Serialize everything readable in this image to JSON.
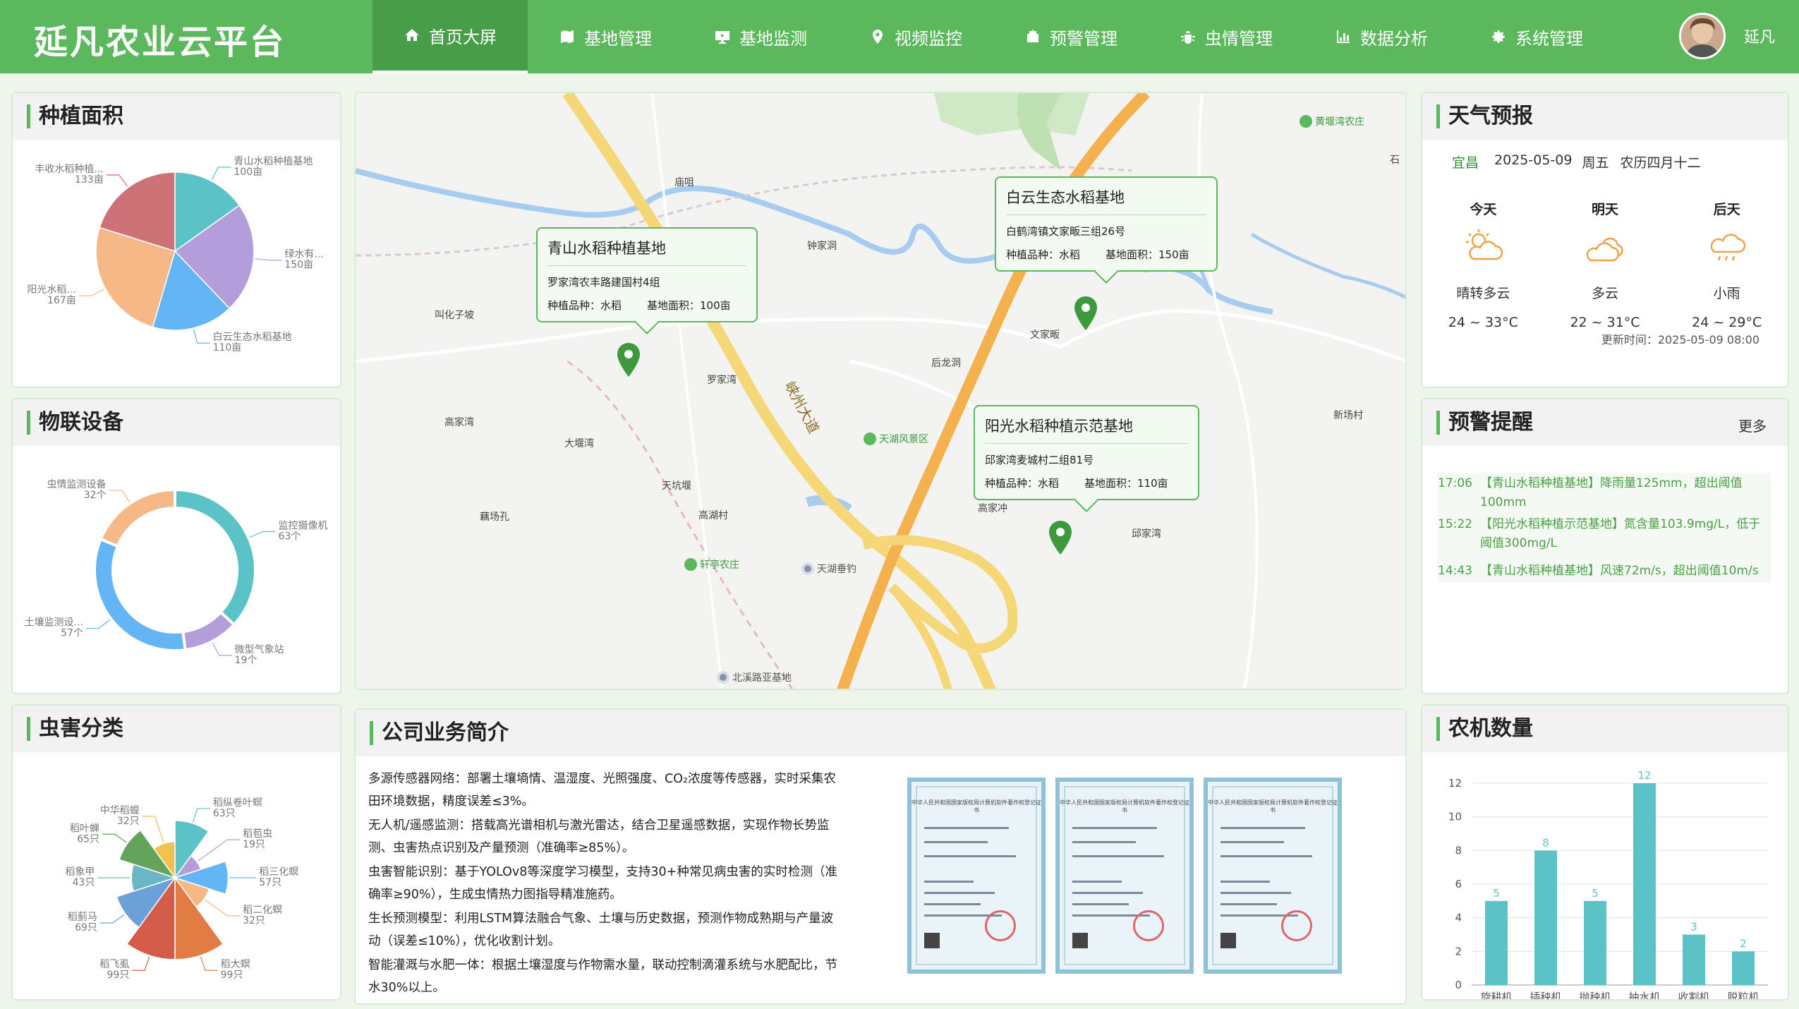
{
  "app": {
    "title": "延凡农业云平台"
  },
  "nav": [
    {
      "label": "首页大屏",
      "icon": "home-icon"
    },
    {
      "label": "基地管理",
      "icon": "map-icon"
    },
    {
      "label": "基地监测",
      "icon": "monitor-icon"
    },
    {
      "label": "视频监控",
      "icon": "location-icon"
    },
    {
      "label": "预警管理",
      "icon": "bell-icon"
    },
    {
      "label": "虫情管理",
      "icon": "bug-icon"
    },
    {
      "label": "数据分析",
      "icon": "chart-icon"
    },
    {
      "label": "系统管理",
      "icon": "gear-icon"
    }
  ],
  "user": {
    "name": "延凡"
  },
  "planting": {
    "title": "种植面积",
    "chart_data": {
      "type": "pie",
      "unit": "亩",
      "slices": [
        {
          "name": "青山水稻种植基地",
          "value": 100,
          "color": "#5bc3c7"
        },
        {
          "name": "绿水有...",
          "value": 150,
          "color": "#b39ddb"
        },
        {
          "name": "白云生态水稻基地",
          "value": 110,
          "color": "#64b5f6"
        },
        {
          "name": "阳光水稻...",
          "value": 167,
          "color": "#f6b886"
        },
        {
          "name": "丰收水稻种植...",
          "value": 133,
          "color": "#cd7378"
        }
      ],
      "labels": [
        "青山水稻种植基地",
        "100亩",
        "绿水有...",
        "150亩",
        "白云生态水稻基地",
        "110亩",
        "阳光水稻...",
        "167亩",
        "丰收水稻种植...",
        "133亩"
      ]
    }
  },
  "iot": {
    "title": "物联设备",
    "chart_data": {
      "type": "pie",
      "variant": "donut",
      "unit": "个",
      "slices": [
        {
          "name": "监控摄像机",
          "value": 63,
          "color": "#5bc3c7"
        },
        {
          "name": "微型气象站",
          "value": 19,
          "color": "#b39ddb"
        },
        {
          "name": "土壤监测设...",
          "value": 57,
          "color": "#64b5f6"
        },
        {
          "name": "虫情监测设备",
          "value": 32,
          "color": "#f6b886"
        }
      ],
      "labels": [
        "监控摄像机",
        "63个",
        "微型气象站",
        "19个",
        "土壤监测设...",
        "57个",
        "虫情监测设备",
        "32个"
      ]
    }
  },
  "pests": {
    "title": "虫害分类",
    "chart_data": {
      "type": "pie",
      "variant": "rose",
      "unit": "只",
      "slices": [
        {
          "name": "稻纵卷叶螟",
          "value": 63,
          "color": "#5bc3c7"
        },
        {
          "name": "稻苞虫",
          "value": 19,
          "color": "#b39ddb"
        },
        {
          "name": "稻三化螟",
          "value": 57,
          "color": "#64b5f6"
        },
        {
          "name": "稻二化螟",
          "value": 32,
          "color": "#f6b886"
        },
        {
          "name": "稻大螟",
          "value": 99,
          "color": "#e07c44"
        },
        {
          "name": "稻飞虱",
          "value": 99,
          "color": "#d45c4a"
        },
        {
          "name": "稻蓟马",
          "value": 69,
          "color": "#6aa1d8"
        },
        {
          "name": "稻象甲",
          "value": 43,
          "color": "#6ab6c4"
        },
        {
          "name": "稻叶蝉",
          "value": 65,
          "color": "#63a35c"
        },
        {
          "name": "中华稻蝗",
          "value": 32,
          "color": "#f2c14e"
        }
      ],
      "labels": [
        "稻纵卷叶螟",
        "63只",
        "稻苞虫",
        "19只",
        "稻三化螟",
        "57只",
        "稻二化螟",
        "32只",
        "稻大螟",
        "99只",
        "稻飞虱",
        "99只",
        "稻蓟马",
        "69只",
        "稻象甲",
        "43只",
        "稻叶蝉",
        "65只",
        "中华稻蝗",
        "32只"
      ]
    }
  },
  "map": {
    "bases": [
      {
        "name": "青山水稻种植基地",
        "address": "罗家湾农丰路建国村4组",
        "crop": "种植品种：水稻",
        "area": "基地面积：100亩"
      },
      {
        "name": "白云生态水稻基地",
        "address": "白鹤湾镇文家畈三组26号",
        "crop": "种植品种：水稻",
        "area": "基地面积：150亩"
      },
      {
        "name": "阳光水稻种植示范基地",
        "address": "邱家湾麦城村二组81号",
        "crop": "种植品种：水稻",
        "area": "基地面积：110亩"
      }
    ],
    "places": [
      "庙咀",
      "钟家洞",
      "叫化子坡",
      "罗家湾",
      "高家湾",
      "大堰湾",
      "后龙洞",
      "文家畈",
      "天坑堰",
      "高湖村",
      "藕场孔",
      "邱家湾",
      "新场村",
      "高家冲",
      "石",
      "峡州大道"
    ],
    "pois": [
      "黄堰湾农庄",
      "天湖风景区",
      "轩亭农庄"
    ],
    "gray_pois": [
      "天湖垂钓",
      "北溪路亚基地"
    ]
  },
  "company": {
    "title": "公司业务简介",
    "paragraphs": [
      "多源传感器网络：部署土壤墒情、温湿度、光照强度、CO₂浓度等传感器，实时采集农田环境数据，精度误差≤3%。",
      "无人机/遥感监测：搭载高光谱相机与激光雷达，结合卫星遥感数据，实现作物长势监测、虫害热点识别及产量预测（准确率≥85%）。",
      "虫害智能识别：基于YOLOv8等深度学习模型，支持30+种常见病虫害的实时检测（准确率≥90%），生成虫情热力图指导精准施药。",
      "生长预测模型：利用LSTM算法融合气象、土壤与历史数据，预测作物成熟期与产量波动（误差≤10%），优化收割计划。",
      "智能灌溉与水肥一体：根据土壤湿度与作物需水量，联动控制滴灌系统与水肥配比，节水30%以上。"
    ],
    "cert_title": "中华人民共和国国家版权局计算机软件著作权登记证书"
  },
  "weather": {
    "title": "天气预报",
    "city": "宜昌",
    "date": "2025-05-09",
    "weekday": "周五",
    "lunar": "农历四月十二",
    "days": [
      {
        "day": "今天",
        "cond": "晴转多云",
        "temp": "24 ~ 33°C",
        "icon": "sun-cloud-icon"
      },
      {
        "day": "明天",
        "cond": "多云",
        "temp": "22 ~ 31°C",
        "icon": "cloud-icon"
      },
      {
        "day": "后天",
        "cond": "小雨",
        "temp": "24 ~ 29°C",
        "icon": "rain-icon"
      }
    ],
    "updated": "更新时间：2025-05-09 08:00"
  },
  "alerts": {
    "title": "预警提醒",
    "more": "更多",
    "items": [
      {
        "time": "17:06",
        "text": "【青山水稻种植基地】降雨量125mm，超出阈值100mm"
      },
      {
        "time": "15:22",
        "text": "【阳光水稻种植示范基地】氮含量103.9mg/L，低于阈值300mg/L"
      },
      {
        "time": "14:43",
        "text": "【青山水稻种植基地】风速72m/s，超出阈值10m/s"
      }
    ]
  },
  "machines": {
    "title": "农机数量",
    "chart_data": {
      "type": "bar",
      "categories": [
        "旋耕机",
        "插秧机",
        "抛秧机",
        "抽水机",
        "收割机",
        "脱粒机"
      ],
      "values": [
        5,
        8,
        5,
        12,
        3,
        2
      ],
      "ylim": [
        0,
        12
      ],
      "yticks": [
        0,
        2,
        4,
        6,
        8,
        10,
        12
      ],
      "color": "#5bc3c7"
    }
  }
}
